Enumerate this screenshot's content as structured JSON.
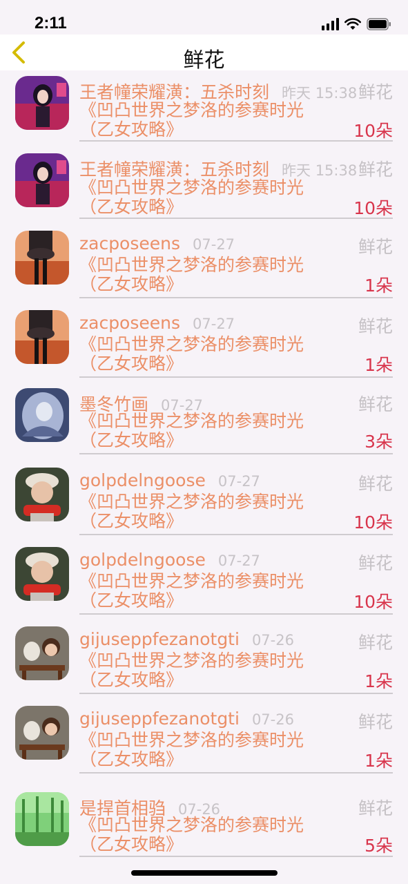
{
  "status": {
    "time": "2:11"
  },
  "nav": {
    "title": "鲜花",
    "back_icon": "chevron-left-icon",
    "accent": "#d4bb00"
  },
  "gift_label": "鲜花",
  "items": [
    {
      "user": "王者幢荣耀潢：五杀时刻",
      "date": "昨天 15:38",
      "book_line1": "《凹凸世界之梦洛的参赛时光",
      "book_line2": "（乙女攻略》",
      "count": "10朵",
      "avatar": "purple-girl"
    },
    {
      "user": "王者幢荣耀潢：五杀时刻",
      "date": "昨天 15:38",
      "book_line1": "《凹凸世界之梦洛的参赛时光",
      "book_line2": "（乙女攻略》",
      "count": "10朵",
      "avatar": "purple-girl"
    },
    {
      "user": "zacposeens",
      "date": "07-27",
      "book_line1": "《凹凸世界之梦洛的参赛时光",
      "book_line2": "（乙女攻略》",
      "count": "1朵",
      "avatar": "autumn-girl"
    },
    {
      "user": "zacposeens",
      "date": "07-27",
      "book_line1": "《凹凸世界之梦洛的参赛时光",
      "book_line2": "（乙女攻略》",
      "count": "1朵",
      "avatar": "autumn-girl"
    },
    {
      "user": "墨冬竹画",
      "date": "07-27",
      "book_line1": "《凹凸世界之梦洛的参赛时光",
      "book_line2": "（乙女攻略》",
      "count": "3朵",
      "avatar": "blue-sketch-girl"
    },
    {
      "user": "golpdelngoose",
      "date": "07-27",
      "book_line1": "《凹凸世界之梦洛的参赛时光",
      "book_line2": "（乙女攻略》",
      "count": "10朵",
      "avatar": "child-red-scarf"
    },
    {
      "user": "golpdelngoose",
      "date": "07-27",
      "book_line1": "《凹凸世界之梦洛的参赛时光",
      "book_line2": "（乙女攻略》",
      "count": "10朵",
      "avatar": "child-red-scarf"
    },
    {
      "user": "gijuseppfezanotgti",
      "date": "07-26",
      "book_line1": "《凹凸世界之梦洛的参赛时光",
      "book_line2": "（乙女攻略》",
      "count": "1朵",
      "avatar": "doll-bench"
    },
    {
      "user": "gijuseppfezanotgti",
      "date": "07-26",
      "book_line1": "《凹凸世界之梦洛的参赛时光",
      "book_line2": "（乙女攻略》",
      "count": "1朵",
      "avatar": "doll-bench"
    },
    {
      "user": "是捍首相驺",
      "date": "07-26",
      "book_line1": "《凹凸世界之梦洛的参赛时光",
      "book_line2": "（乙女攻略》",
      "count": "5朵",
      "avatar": "green-forest"
    }
  ]
}
